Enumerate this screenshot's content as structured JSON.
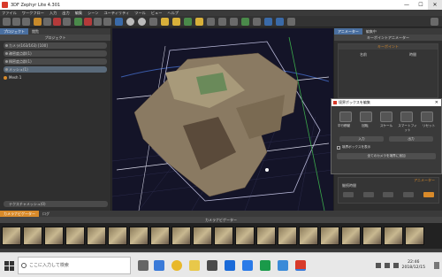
{
  "window": {
    "title": "3DF Zephyr Lite 4.301",
    "controls": [
      "—",
      "☐",
      "✕"
    ]
  },
  "menu": [
    "ファイル",
    "ワークフロー",
    "入力",
    "出力",
    "編集",
    "シーン",
    "ユーティリティ",
    "ツール",
    "ビュー",
    "ヘルプ"
  ],
  "left_panel": {
    "tabs": [
      "プロジェクト",
      "閲覧"
    ],
    "header": "プロジェクト",
    "rows": [
      "カメラ(163/163) [100]",
      "疎密度点群(1)",
      "稠密度点群(1)",
      "メッシュ(1)"
    ],
    "tree_item": "Mesh 1",
    "bottom_box": "テクスチャメッシュ(0)"
  },
  "right_panel": {
    "tabs": [
      "アニメーター",
      "編集中"
    ],
    "header": "キーポイントアニメーター",
    "section": "キーポイント",
    "columns": [
      "名前",
      "時間"
    ],
    "bottom_section": "アニメーター",
    "bottom_label": "継続時間"
  },
  "dialog": {
    "title": "境界ボックスを編集",
    "buttons": [
      "平行移動",
      "回転",
      "スケール",
      "スマートフィット",
      "リセット"
    ],
    "row_buttons": [
      "入力",
      "出力"
    ],
    "checkbox": "境界ボックスを表示",
    "wide_button": "全てのカメラを境界に追加"
  },
  "bottom": {
    "tabs": [
      "カメラナビゲーター",
      "ログ"
    ],
    "header": "カメラナビゲーター"
  },
  "taskbar": {
    "search_placeholder": "ここに入力して検索",
    "time": "22:46",
    "date": "2018/12/15"
  }
}
